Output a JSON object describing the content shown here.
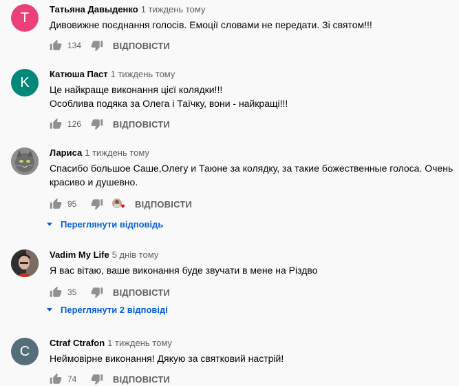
{
  "colors": {
    "link": "#065fd4",
    "secondary": "#606060"
  },
  "comments": [
    {
      "avatar_letter": "T",
      "avatar_color": "#ec407a",
      "author": "Татьяна Давыденко",
      "time": "1 тиждень тому",
      "lines": [
        "Дивовижне поєднання голосів. Емоції словами не передати. Зі святом!!!"
      ],
      "likes": "134",
      "reply": "ВІДПОВІСТИ"
    },
    {
      "avatar_letter": "K",
      "avatar_color": "#00897b",
      "author": "Катюша Паст",
      "time": "1 тиждень тому",
      "lines": [
        "Це найкраще виконання цієї колядки!!!",
        "Особлива подяка за Олега і Таїчку, вони - найкращі!!!"
      ],
      "likes": "126",
      "reply": "ВІДПОВІСТИ"
    },
    {
      "avatar_icon": "cat-photo-avatar",
      "author": "Лариса",
      "time": "1 тиждень тому",
      "lines": [
        "Спасибо большое Саше,Олегу и Таюне за колядку, за такие божественные голоса. Очень",
        "красиво и душевно."
      ],
      "likes": "95",
      "reply": "ВІДПОВІСТИ",
      "view_replies": "Переглянути відповідь"
    },
    {
      "avatar_icon": "person-photo-avatar",
      "author": "Vadim My Life",
      "time": "5 днів тому",
      "lines": [
        "Я вас вітаю, ваше виконання буде звучати в мене на Різдво"
      ],
      "likes": "35",
      "reply": "ВІДПОВІСТИ",
      "view_replies": "Переглянути 2 відповіді"
    },
    {
      "avatar_letter": "C",
      "avatar_color": "#546e7a",
      "author": "Ctraf Ctrafon",
      "time": "1 тиждень тому",
      "lines": [
        "Неймовірне виконання! Дякую за святковий настрій!"
      ],
      "likes": "74",
      "reply": "ВІДПОВІСТИ"
    }
  ]
}
